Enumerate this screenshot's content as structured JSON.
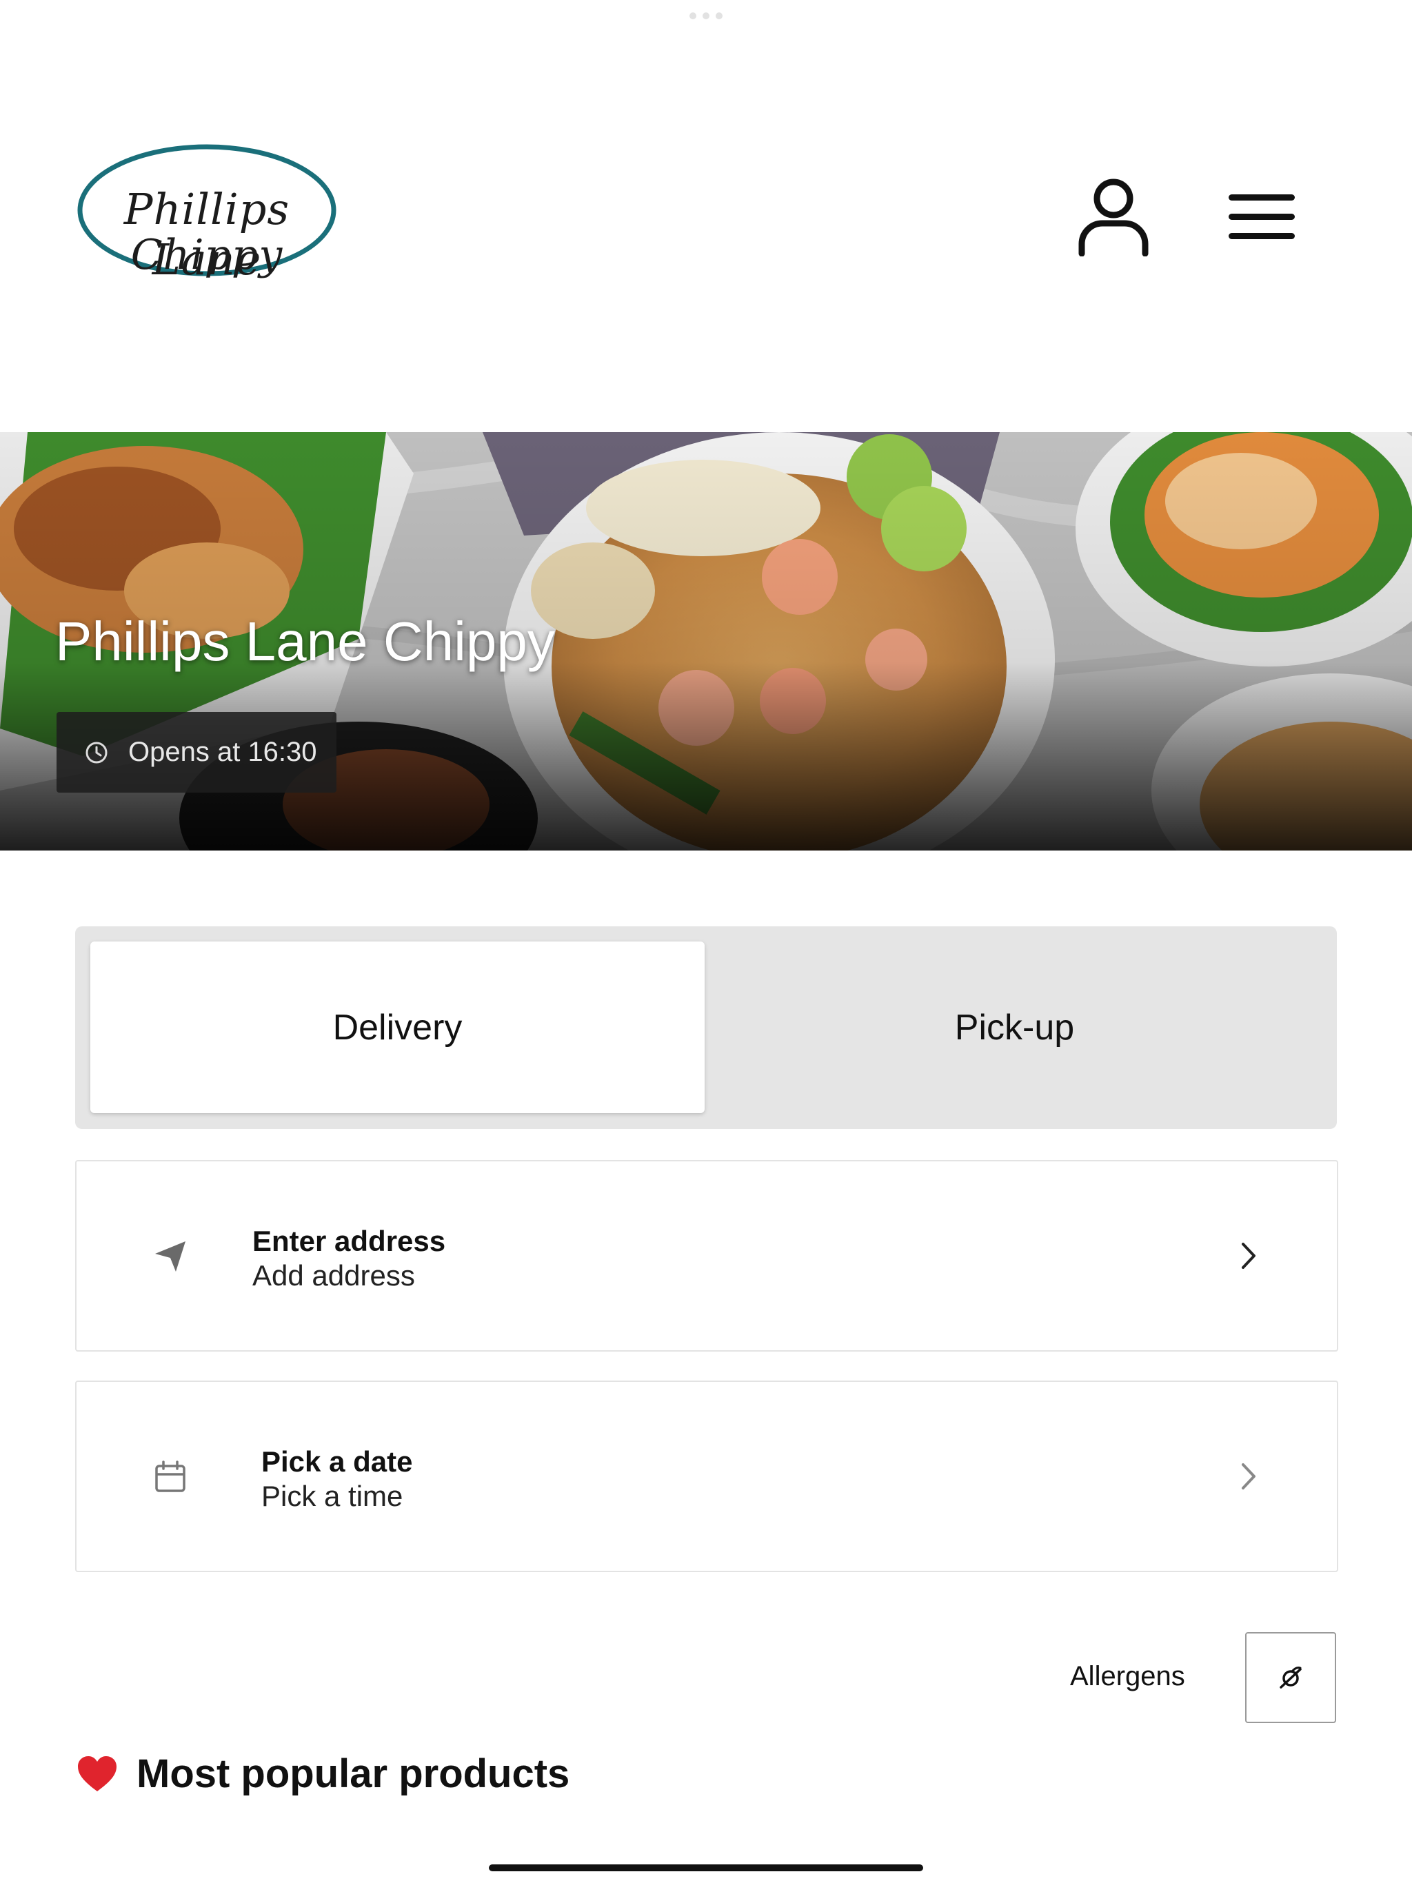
{
  "header": {
    "logo": {
      "line1": "Phillips Lane",
      "line2": "Chippy",
      "ring_color": "#1a6f7a"
    },
    "account_icon": "user-icon",
    "menu_icon": "hamburger-menu-icon"
  },
  "hero": {
    "title": "Phillips Lane Chippy",
    "status": "Opens at 16:30",
    "status_icon": "clock-icon"
  },
  "order_mode": {
    "options": [
      "Delivery",
      "Pick-up"
    ],
    "selected": "Delivery"
  },
  "address_row": {
    "icon": "location-arrow-icon",
    "title": "Enter address",
    "subtitle": "Add address"
  },
  "schedule_row": {
    "icon": "calendar-icon",
    "title": "Pick a date",
    "subtitle": "Pick a time"
  },
  "allergens": {
    "label": "Allergens",
    "icon": "allergen-icon"
  },
  "popular": {
    "icon": "heart-icon",
    "title": "Most popular products"
  },
  "colors": {
    "toggle_bg": "#e5e5e5",
    "border": "#e3e3e3",
    "text": "#111111"
  }
}
